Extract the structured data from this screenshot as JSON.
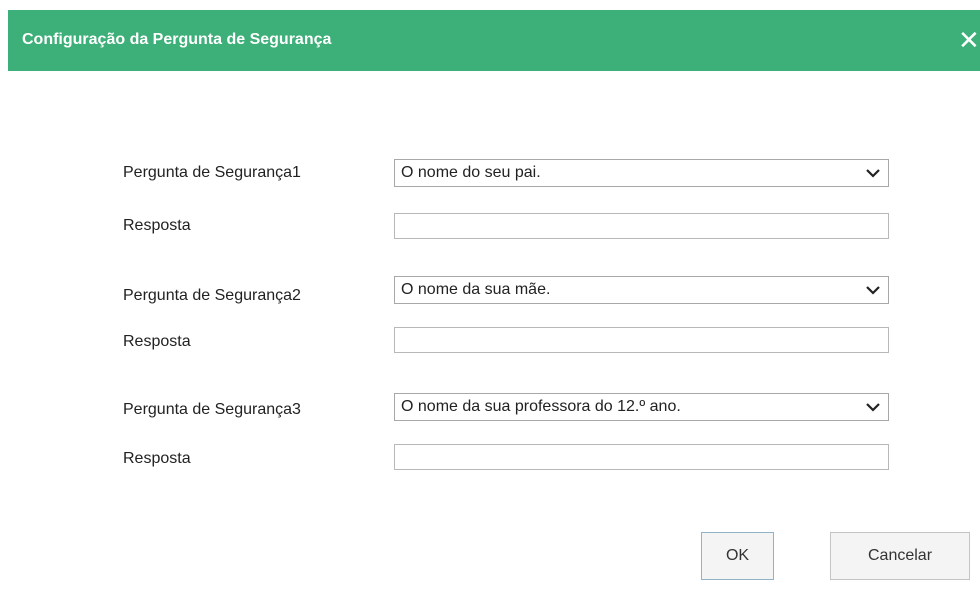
{
  "dialog": {
    "title": "Configuração da Pergunta de Segurança",
    "close_symbol": "✕",
    "close_icon": "close-icon"
  },
  "questions": [
    {
      "label": "Pergunta de Segurança1",
      "selected": "O nome do seu pai.",
      "answer_label": "Resposta",
      "answer_value": ""
    },
    {
      "label": "Pergunta de Segurança2",
      "selected": "O nome da sua mãe.",
      "answer_label": "Resposta",
      "answer_value": ""
    },
    {
      "label": "Pergunta de Segurança3",
      "selected": "O nome da sua professora do 12.º ano.",
      "answer_label": "Resposta",
      "answer_value": ""
    }
  ],
  "buttons": {
    "ok_label": "OK",
    "cancel_label": "Cancelar"
  },
  "colors": {
    "header_bg": "#3daf78",
    "header_text": "#ffffff"
  }
}
